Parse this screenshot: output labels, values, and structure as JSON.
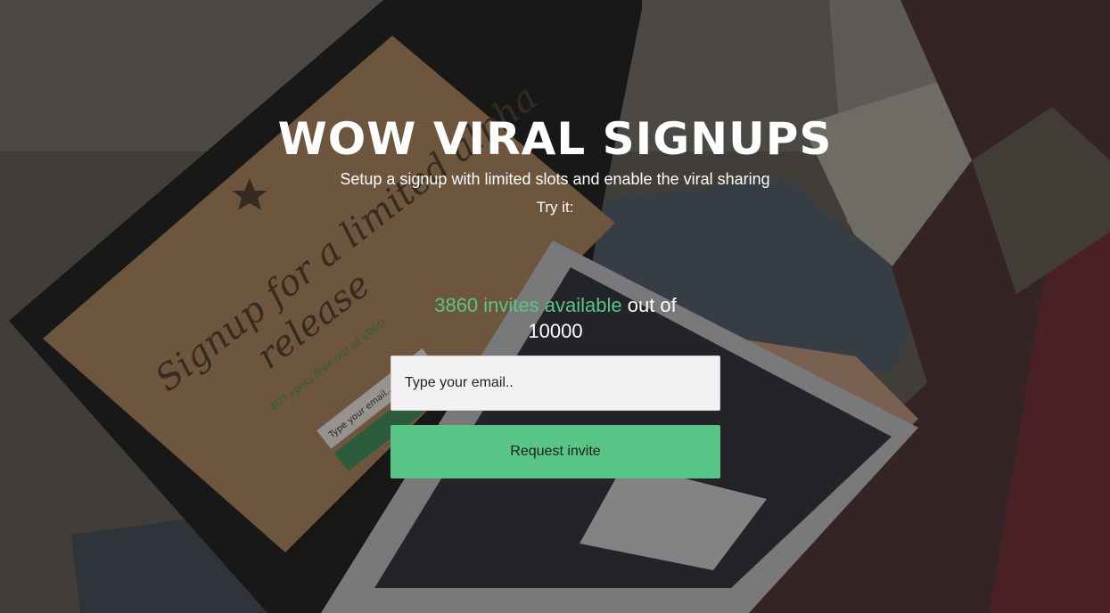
{
  "hero": {
    "title": "WOW VIRAL SIGNUPS",
    "subtitle": "Setup a signup with limited slots and enable the viral sharing",
    "try_label": "Try it:"
  },
  "signup": {
    "available_count": "3860",
    "available_label": "invites available",
    "out_of_label": "out of",
    "total": "10000",
    "email_placeholder": "Type your email..",
    "button_label": "Request invite"
  },
  "background": {
    "laptop_screen_text_1": "Signup for a limited alpha",
    "laptop_screen_text_2": "release",
    "laptop_screen_text_3": "497 spots free out of 2000",
    "laptop_screen_text_4": "Type your email..",
    "accent": "#58c587"
  },
  "colors": {
    "accent": "#58c587",
    "text": "#ffffff",
    "field_bg": "#f3f1f3"
  }
}
